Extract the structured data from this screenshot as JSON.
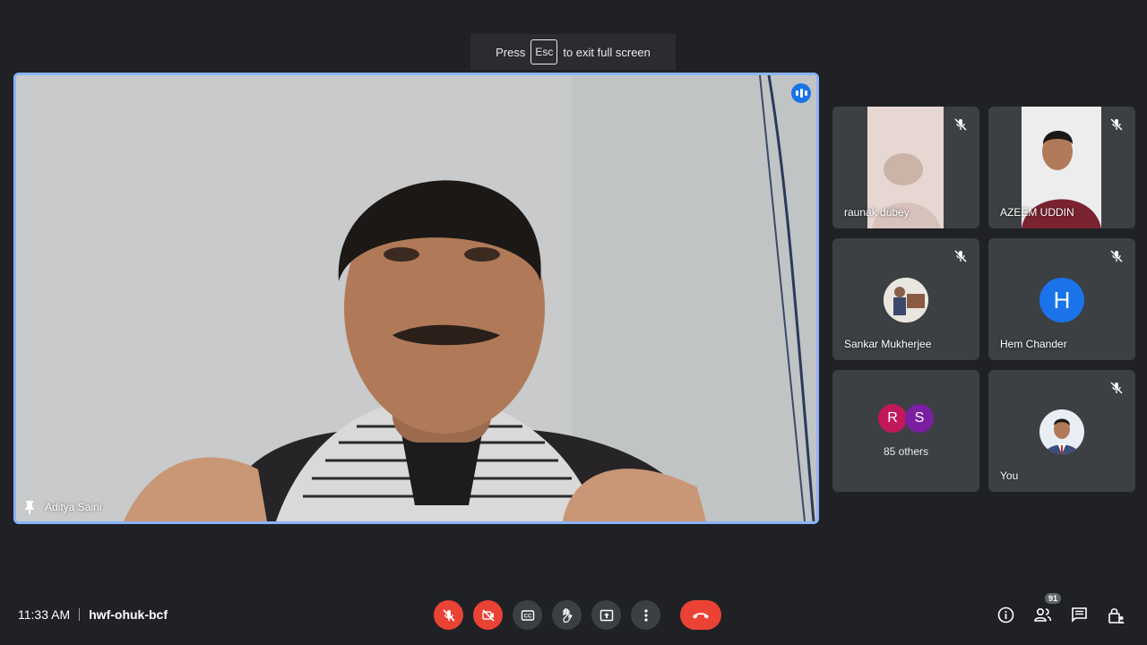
{
  "toast": {
    "press": "Press",
    "key": "Esc",
    "suffix": "to exit full screen"
  },
  "main_speaker": {
    "name": "Aditya Saini",
    "speaking": true
  },
  "participants": [
    {
      "name": "raunak dubey",
      "muted": true,
      "type": "video"
    },
    {
      "name": "AZEEM UDDIN",
      "muted": true,
      "type": "video"
    },
    {
      "name": "Sankar Mukherjee",
      "muted": true,
      "type": "photo"
    },
    {
      "name": "Hem Chander",
      "muted": true,
      "type": "letter",
      "letter": "H",
      "color": "#1a73e8"
    },
    {
      "name": "You",
      "muted": true,
      "type": "photo"
    }
  ],
  "others": {
    "initials": [
      {
        "letter": "R",
        "color": "#c2185b"
      },
      {
        "letter": "S",
        "color": "#7b1fa2"
      }
    ],
    "label": "85 others"
  },
  "bottom_bar": {
    "time": "11:33 AM",
    "meeting_code": "hwf-ohuk-bcf",
    "participant_count": "91"
  },
  "colors": {
    "accent": "#8ab4f8",
    "danger": "#ea4335",
    "background": "#202124",
    "tile": "#3c4043"
  }
}
